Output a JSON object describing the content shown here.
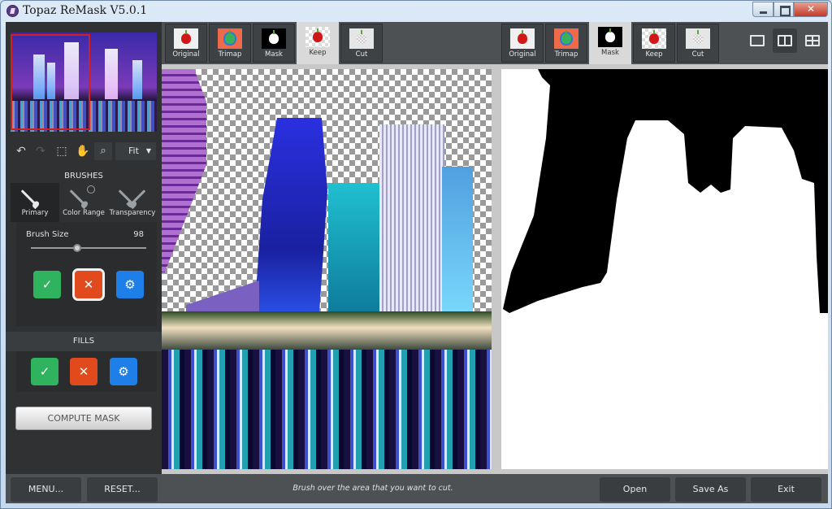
{
  "window": {
    "title": "Topaz ReMask V5.0.1",
    "controls": {
      "minimize": "minimize",
      "maximize": "maximize",
      "close": "✕"
    }
  },
  "toolbar": {
    "undo_icon": "↶",
    "redo_icon": "↷",
    "selection_icon": "⬚",
    "hand_icon": "✋",
    "zoom_icon": "🔍",
    "zoom_select": {
      "value": "Fit",
      "arrow": "▼"
    }
  },
  "brushes": {
    "title": "BRUSHES",
    "tabs": [
      {
        "label": "Primary",
        "active": true
      },
      {
        "label": "Color Range",
        "active": false
      },
      {
        "label": "Transparency",
        "active": false
      }
    ],
    "brush_size": {
      "label": "Brush Size",
      "value": "98",
      "fraction": 0.4
    },
    "actions": [
      {
        "name": "keep-brush",
        "color": "#2fb35f",
        "glyph": "✓",
        "selected": false
      },
      {
        "name": "cut-brush",
        "color": "#e04a1c",
        "glyph": "✕",
        "selected": true
      },
      {
        "name": "compute-brush",
        "color": "#1e7fe8",
        "glyph": "⚙",
        "selected": false
      }
    ]
  },
  "fills": {
    "title": "FILLS",
    "actions": [
      {
        "name": "keep-fill",
        "color": "#2fb35f",
        "glyph": "✓"
      },
      {
        "name": "cut-fill",
        "color": "#e04a1c",
        "glyph": "✕"
      },
      {
        "name": "compute-fill",
        "color": "#1e7fe8",
        "glyph": "⚙"
      }
    ]
  },
  "compute_mask_label": "COMPUTE MASK",
  "left_view_tabs": [
    {
      "label": "Original",
      "active": false
    },
    {
      "label": "Trimap",
      "active": false
    },
    {
      "label": "Mask",
      "active": false
    },
    {
      "label": "Keep",
      "active": true
    },
    {
      "label": "Cut",
      "active": false
    }
  ],
  "right_view_tabs": [
    {
      "label": "Original",
      "active": false
    },
    {
      "label": "Trimap",
      "active": false
    },
    {
      "label": "Mask",
      "active": true
    },
    {
      "label": "Keep",
      "active": false
    },
    {
      "label": "Cut",
      "active": false
    }
  ],
  "layout_modes": [
    {
      "name": "single-view",
      "active": false
    },
    {
      "name": "split-view",
      "active": true
    },
    {
      "name": "quad-view",
      "active": false
    }
  ],
  "bottom": {
    "menu_label": "MENU...",
    "reset_label": "RESET...",
    "status": "Brush over the area that you want to cut.",
    "open_label": "Open",
    "save_as_label": "Save As",
    "exit_label": "Exit"
  },
  "colors": {
    "accent_red": "#d02020",
    "keep_green": "#2fb35f",
    "cut_orange": "#e04a1c",
    "compute_blue": "#1e7fe8"
  }
}
